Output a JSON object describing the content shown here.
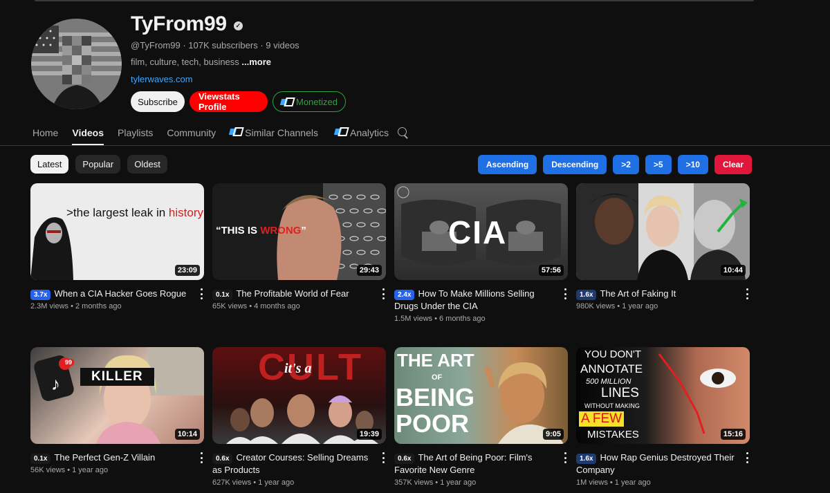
{
  "channel": {
    "name": "TyFrom99",
    "meta": "@TyFrom99 · 107K subscribers · 9 videos",
    "description": "film, culture, tech, business ",
    "more": "...more",
    "link": "tylerwaves.com",
    "verified_icon": "check-icon"
  },
  "actions": {
    "subscribe": "Subscribe",
    "viewstats": "Viewstats Profile",
    "monetized": "Monetized"
  },
  "tabs": {
    "home": "Home",
    "videos": "Videos",
    "playlists": "Playlists",
    "community": "Community",
    "similar": "Similar Channels",
    "analytics": "Analytics"
  },
  "filters": {
    "latest": "Latest",
    "popular": "Popular",
    "oldest": "Oldest"
  },
  "sort": {
    "ascending": "Ascending",
    "descending": "Descending",
    "gt2": ">2",
    "gt5": ">5",
    "gt10": ">10",
    "clear": "Clear"
  },
  "colors": {
    "accent_blue": "#1f6fe5",
    "clear_red": "#e0173a",
    "viewstats_red": "#ff0000",
    "monetized_green": "#2ba640",
    "link_blue": "#3ea6ff"
  },
  "videos": [
    {
      "thumb_text": ">the largest leak in ",
      "thumb_text_hl": "history",
      "duration": "23:09",
      "outlier": "3.7x",
      "title": "When a CIA Hacker Goes Rogue",
      "stats": "2.3M views • 2 months ago"
    },
    {
      "thumb_text": "“THIS IS ",
      "thumb_text_hl": "WRONG",
      "thumb_text_end": "”",
      "duration": "29:43",
      "outlier": "0.1x",
      "title": "The Profitable World of Fear",
      "stats": "65K views • 4 months ago"
    },
    {
      "thumb_text": "CIA",
      "duration": "57:56",
      "outlier": "2.4x",
      "title": "How To Make Millions Selling Drugs Under the CIA",
      "stats": "1.5M views • 6 months ago"
    },
    {
      "duration": "10:44",
      "outlier": "1.6x",
      "title": "The Art of Faking It",
      "stats": "980K views • 1 year ago"
    },
    {
      "thumb_text": "KILLER",
      "badge": "99",
      "duration": "10:14",
      "outlier": "0.1x",
      "title": "The Perfect Gen-Z Villain",
      "stats": "56K views • 1 year ago"
    },
    {
      "thumb_text": "CULT",
      "thumb_text_small": "it's a",
      "duration": "19:39",
      "outlier": "0.6x",
      "title": "Creator Courses: Selling Dreams as Products",
      "stats": "627K views • 1 year ago"
    },
    {
      "thumb_text": "THE ART",
      "thumb_text_small": "OF",
      "thumb_text_2": "BEING",
      "thumb_text_3": "POOR",
      "duration": "9:05",
      "outlier": "0.6x",
      "title": "The Art of Being Poor: Film's Favorite New Genre",
      "stats": "357K views • 1 year ago"
    },
    {
      "thumb_text": "YOU DON'T",
      "thumb_text_2": "ANNOTATE",
      "thumb_text_3": "500 MILLION",
      "thumb_text_4": "LINES",
      "thumb_text_5": "WITHOUT MAKING",
      "thumb_text_6": "A FEW",
      "thumb_text_7": "MISTAKES",
      "duration": "15:16",
      "outlier": "1.6x",
      "title": "How Rap Genius Destroyed Their Company",
      "stats": "1M views • 1 year ago"
    }
  ]
}
